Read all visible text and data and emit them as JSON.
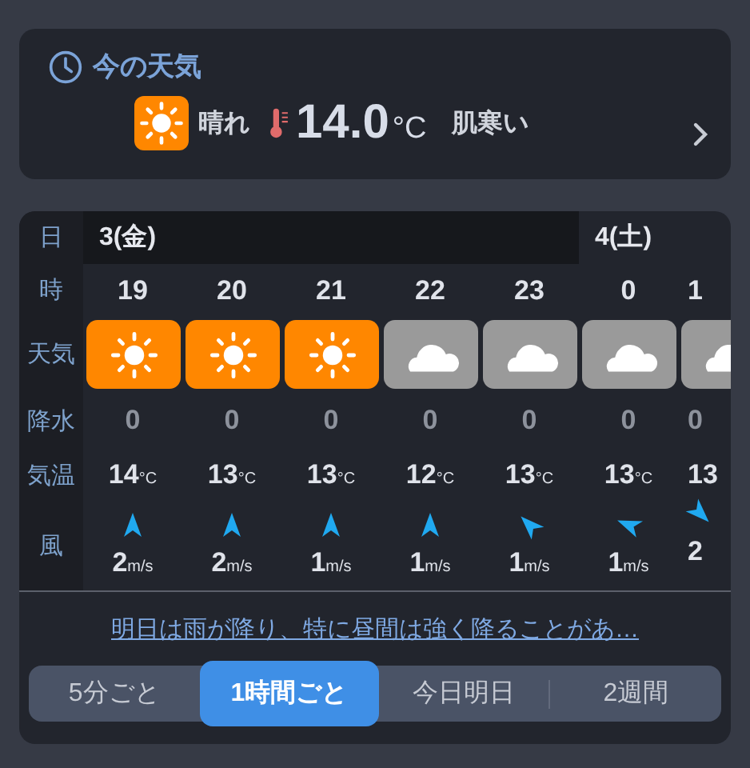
{
  "current": {
    "title": "今の天気",
    "kind": "sunny",
    "condition": "晴れ",
    "temperature": "14.0",
    "unit": "°C",
    "feeling": "肌寒い"
  },
  "forecast": {
    "row_labels": [
      "日",
      "時",
      "天気",
      "降水",
      "気温",
      "風"
    ],
    "days": [
      {
        "label": "3(金)",
        "hours": [
          {
            "hour": "19",
            "kind": "sunny",
            "rain": "0",
            "temp": "14",
            "temp_unit": "°C",
            "wind": {
              "speed": "2",
              "unit": "m/s",
              "kind": "north"
            }
          },
          {
            "hour": "20",
            "kind": "sunny",
            "rain": "0",
            "temp": "13",
            "temp_unit": "°C",
            "wind": {
              "speed": "2",
              "unit": "m/s",
              "kind": "north"
            }
          },
          {
            "hour": "21",
            "kind": "sunny",
            "rain": "0",
            "temp": "13",
            "temp_unit": "°C",
            "wind": {
              "speed": "1",
              "unit": "m/s",
              "kind": "north"
            }
          },
          {
            "hour": "22",
            "kind": "cloudy",
            "rain": "0",
            "temp": "12",
            "temp_unit": "°C",
            "wind": {
              "speed": "1",
              "unit": "m/s",
              "kind": "north"
            }
          },
          {
            "hour": "23",
            "kind": "cloudy",
            "rain": "0",
            "temp": "13",
            "temp_unit": "°C",
            "wind": {
              "speed": "1",
              "unit": "m/s",
              "kind": "northwest"
            }
          }
        ]
      },
      {
        "label": "4(土)",
        "hours": [
          {
            "hour": "0",
            "kind": "cloudy",
            "rain": "0",
            "temp": "13",
            "temp_unit": "°C",
            "wind": {
              "speed": "1",
              "unit": "m/s",
              "kind": "westnorthwest"
            }
          },
          {
            "hour": "1",
            "kind": "cloudy",
            "rain": "0",
            "temp": "13",
            "wind": {
              "speed": "2",
              "kind": "southeast"
            }
          }
        ]
      }
    ]
  },
  "summary_link": "明日は雨が降り、特に昼間は強く降ることがあ…",
  "tabs": [
    {
      "label": "5分ごと",
      "selected": false
    },
    {
      "label": "1時間ごと",
      "selected": true
    },
    {
      "label": "今日明日",
      "selected": false
    },
    {
      "label": "2週間",
      "selected": false
    }
  ]
}
